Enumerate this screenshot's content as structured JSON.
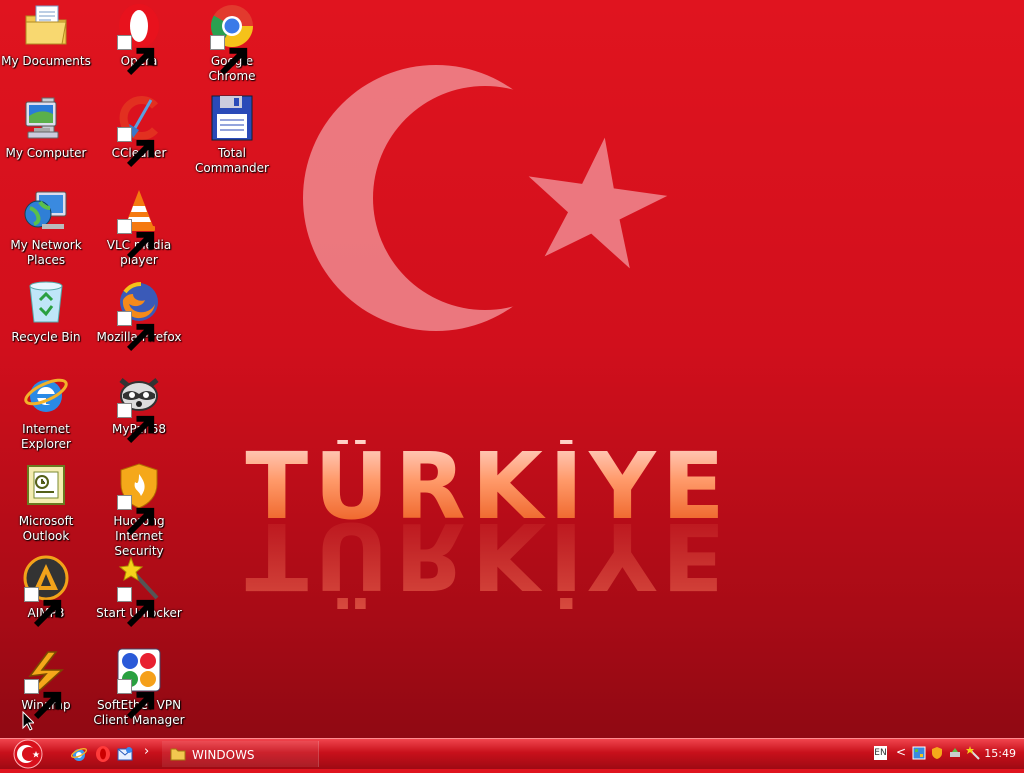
{
  "desktop": {
    "banner_text": "TÜRKİYE",
    "icons": [
      {
        "label": "My Documents",
        "icon": "folder-documents-icon",
        "shortcut": false
      },
      {
        "label": "My Computer",
        "icon": "computer-icon",
        "shortcut": false
      },
      {
        "label": "My Network Places",
        "icon": "network-places-icon",
        "shortcut": false
      },
      {
        "label": "Recycle Bin",
        "icon": "recycle-bin-icon",
        "shortcut": false
      },
      {
        "label": "Internet Explorer",
        "icon": "internet-explorer-icon",
        "shortcut": false
      },
      {
        "label": "Microsoft Outlook",
        "icon": "outlook-icon",
        "shortcut": false
      },
      {
        "label": "AIMP3",
        "icon": "aimp-icon",
        "shortcut": true
      },
      {
        "label": "Winamp",
        "icon": "winamp-icon",
        "shortcut": true
      },
      {
        "label": "Opera",
        "icon": "opera-icon",
        "shortcut": true
      },
      {
        "label": "CCleaner",
        "icon": "ccleaner-icon",
        "shortcut": true
      },
      {
        "label": "VLC media player",
        "icon": "vlc-icon",
        "shortcut": true
      },
      {
        "label": "Mozilla Firefox",
        "icon": "firefox-icon",
        "shortcut": true
      },
      {
        "label": "MyPal 68",
        "icon": "mypal-icon",
        "shortcut": true
      },
      {
        "label": "Huorong Internet Security",
        "icon": "huorong-icon",
        "shortcut": true
      },
      {
        "label": "Start Unlocker",
        "icon": "wand-icon",
        "shortcut": true
      },
      {
        "label": "SoftEther VPN Client Manager",
        "icon": "softether-icon",
        "shortcut": true
      },
      {
        "label": "Google Chrome",
        "icon": "chrome-icon",
        "shortcut": true
      },
      {
        "label": "Total Commander",
        "icon": "floppy-icon",
        "shortcut": false
      }
    ]
  },
  "taskbar": {
    "start_icon": "start-crescent-icon",
    "quick_launch": [
      "internet-explorer-icon",
      "opera-icon",
      "outlook-express-icon"
    ],
    "overflow": "›",
    "task_label": "WINDOWS",
    "language": "EN",
    "tray_chevron": "<",
    "clock": "15:49"
  },
  "colors": {
    "background": "#d10f1c",
    "taskbar": "#c8101b",
    "text": "#ffffff"
  }
}
